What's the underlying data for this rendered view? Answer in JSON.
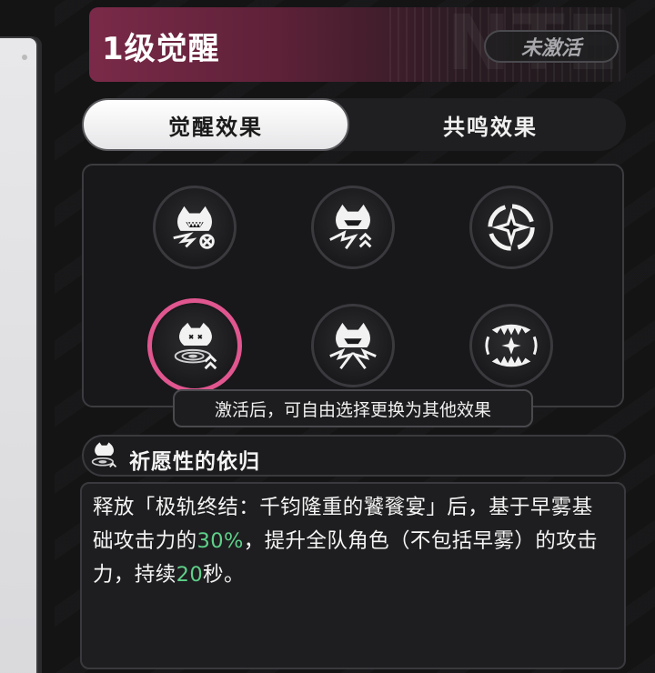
{
  "header": {
    "level_title": "1级觉醒",
    "status": "未激活",
    "watermark": "NTE"
  },
  "tabs": [
    {
      "label": "觉醒效果",
      "active": true
    },
    {
      "label": "共鸣效果",
      "active": false
    }
  ],
  "nodes": [
    {
      "icon": "beast-roar-cancel-icon",
      "selected": false
    },
    {
      "icon": "beast-roar-upgrade-icon",
      "selected": false
    },
    {
      "icon": "star-burst-icon",
      "selected": false
    },
    {
      "icon": "beast-ripple-upgrade-icon",
      "selected": true
    },
    {
      "icon": "beast-roar-shatter-icon",
      "selected": false
    },
    {
      "icon": "fang-maw-icon",
      "selected": false
    }
  ],
  "tooltip": "激活后，可自由选择更换为其他效果",
  "effect": {
    "name": "祈愿性的依归",
    "desc_part1": "释放「极轨终结：千钧隆重的饕餮宴」后，基于早雾基础攻击力的",
    "desc_value1": "30%",
    "desc_part2": "，提升全队角色（不包括早雾）的攻击力，持续",
    "desc_value2": "20",
    "desc_part3": "秒。"
  },
  "colors": {
    "accent_pink": "#e0568f",
    "highlight_green": "#5fd08a",
    "banner": "#7a2a48"
  }
}
